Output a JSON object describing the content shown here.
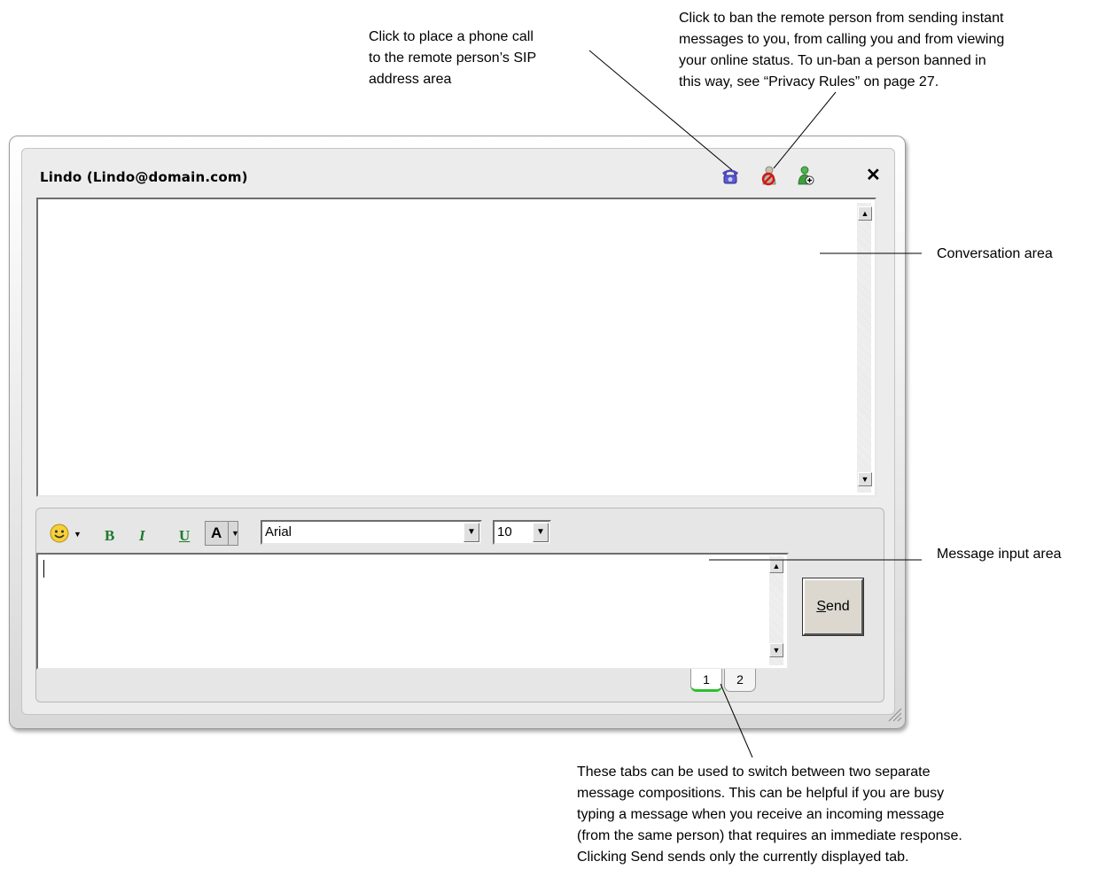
{
  "window": {
    "title": "Lindo (Lindo@domain.com)",
    "close_label": "✕"
  },
  "title_icons": [
    "phone-icon",
    "ban-icon",
    "add-contact-icon"
  ],
  "toolbar": {
    "emoticon_icon": "smiley-icon",
    "bold": "B",
    "italic": "I",
    "underline": "U",
    "font_color": "A",
    "font_name": "Arial",
    "font_size": "10"
  },
  "message_input": {
    "value": ""
  },
  "send_button": {
    "label": "Send",
    "mnemonic": "S",
    "rest": "end"
  },
  "tabs": [
    {
      "label": "1",
      "active": true
    },
    {
      "label": "2",
      "active": false
    }
  ],
  "callouts": {
    "phone": "Click to place a phone call\nto the remote person’s SIP\naddress area",
    "ban": "Click to ban the remote person from sending instant\nmessages to you, from calling you and from viewing\nyour online status.  To un-ban a person banned in\nthis way, see “Privacy Rules” on page 27.",
    "conversation": "Conversation area",
    "message_input": "Message input area",
    "tabs": "These tabs can be used to switch between two separate\nmessage compositions. This can be helpful if you are busy\ntyping a message when you receive an incoming message\n(from the same person) that requires an immediate response.\nClicking Send sends only the currently displayed tab."
  },
  "colors": {
    "active_tab_underline": "#2fbf2f",
    "format_buttons": "#1e7a2e",
    "phone_icon": "#4a4ab8",
    "ban_icon": "#d01818"
  }
}
